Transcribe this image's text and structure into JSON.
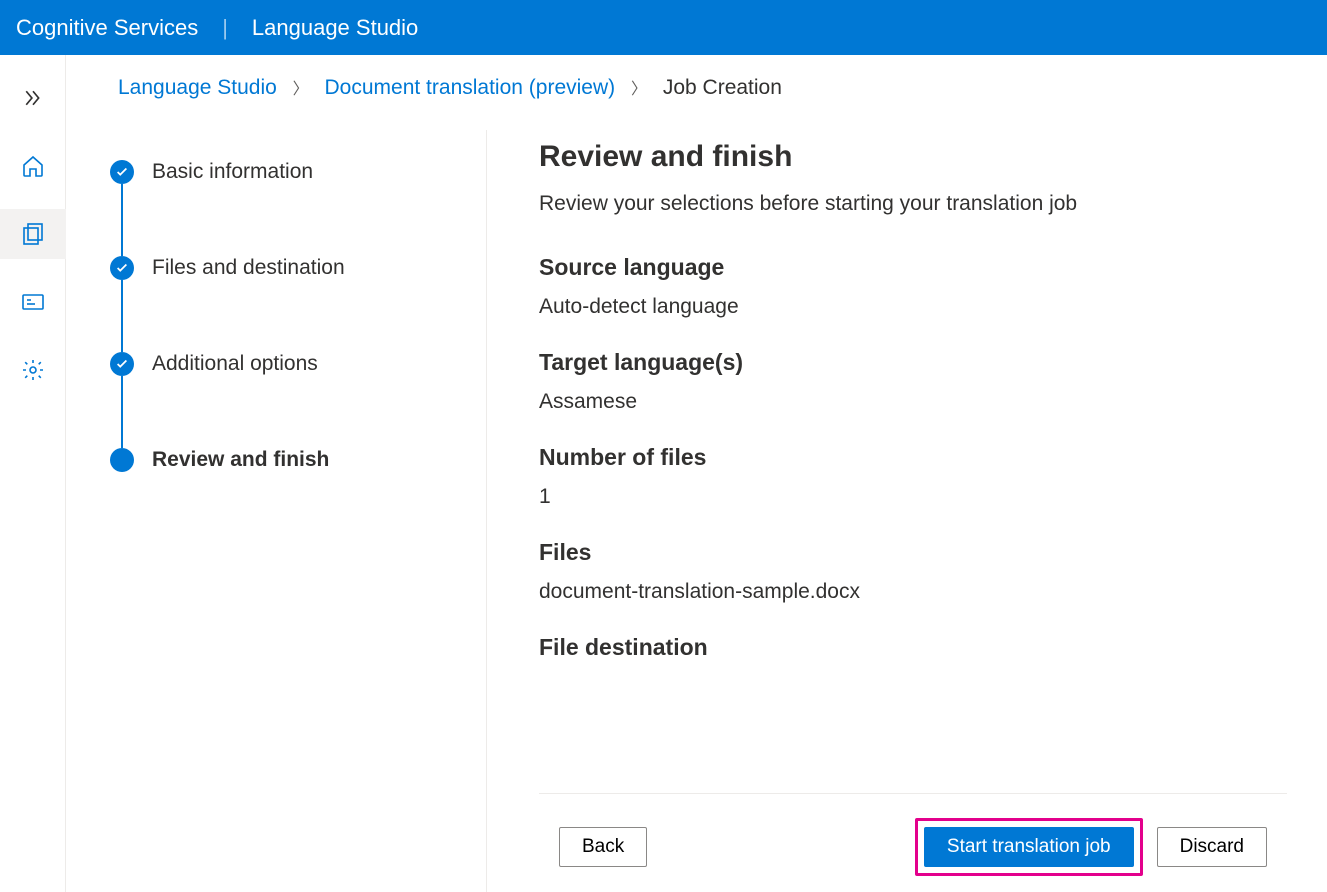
{
  "topbar": {
    "brand": "Cognitive Services",
    "product": "Language Studio"
  },
  "breadcrumb": {
    "root": "Language Studio",
    "section": "Document translation (preview)",
    "current": "Job Creation"
  },
  "steps": {
    "s1": "Basic information",
    "s2": "Files and destination",
    "s3": "Additional options",
    "s4": "Review and finish"
  },
  "review": {
    "title": "Review and finish",
    "subtitle": "Review your selections before starting your translation job",
    "source_label": "Source language",
    "source_value": "Auto-detect language",
    "target_label": "Target language(s)",
    "target_value": "Assamese",
    "numfiles_label": "Number of files",
    "numfiles_value": "1",
    "files_label": "Files",
    "files_value": "document-translation-sample.docx",
    "dest_label": "File destination"
  },
  "buttons": {
    "back": "Back",
    "start": "Start translation job",
    "discard": "Discard"
  }
}
